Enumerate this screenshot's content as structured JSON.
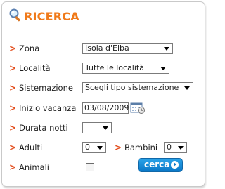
{
  "title": "RICERCA",
  "marker": ">",
  "fields": {
    "zona": {
      "label": "Zona",
      "value": "Isola d'Elba"
    },
    "localita": {
      "label": "Località",
      "value": "Tutte le località"
    },
    "sistemazione": {
      "label": "Sistemazione",
      "value": "Scegli tipo sistemazione"
    },
    "inizio": {
      "label": "Inizio vacanza",
      "value": "03/08/2009"
    },
    "durata": {
      "label": "Durata notti",
      "value": ""
    },
    "adulti": {
      "label": "Adulti",
      "value": "0"
    },
    "bambini": {
      "label": "Bambini",
      "value": "0"
    },
    "animali": {
      "label": "Animali",
      "checked": false
    }
  },
  "button": {
    "label": "cerca"
  },
  "icons": {
    "search": "magnifier-icon",
    "calendar": "calendar-icon",
    "go": "play-arrow-icon"
  },
  "colors": {
    "accent": "#f07a1a",
    "marker": "#e34f1e",
    "button": "#0a77c7"
  }
}
